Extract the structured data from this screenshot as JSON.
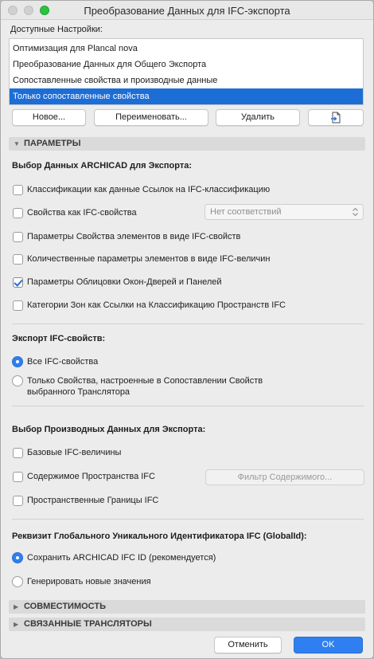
{
  "window": {
    "title": "Преобразование Данных для IFC-экспорта"
  },
  "presets": {
    "label": "Доступные Настройки:",
    "items": [
      "Оптимизация для Plancal nova",
      "Преобразование Данных для Общего Экспорта",
      "Сопоставленные свойства и производные данные",
      "Только сопоставленные свойства"
    ],
    "selected_index": 3
  },
  "preset_buttons": {
    "new": "Новое...",
    "rename": "Переименовать...",
    "delete": "Удалить",
    "import_icon": "import-icon"
  },
  "sections": {
    "params": "ПАРАМЕТРЫ",
    "compat": "СОВМЕСТИМОСТЬ",
    "linked": "СВЯЗАННЫЕ ТРАНСЛЯТОРЫ"
  },
  "export_data": {
    "heading": "Выбор Данных ARCHICAD для Экспорта:",
    "options": [
      {
        "label": "Классификации как данные Ссылок на IFC-классификацию",
        "checked": false
      },
      {
        "label": "Свойства как IFC-свойства",
        "checked": false
      },
      {
        "label": "Параметры Свойства элементов в виде IFC-свойств",
        "checked": false
      },
      {
        "label": "Количественные параметры элементов в виде IFC-величин",
        "checked": false
      },
      {
        "label": "Параметры Облицовки Окон-Дверей и Панелей",
        "checked": true
      },
      {
        "label": "Категории Зон как Ссылки на Классификацию Пространств IFC",
        "checked": false
      }
    ],
    "mapping_select": "Нет соответствий"
  },
  "ifc_props": {
    "heading": "Экспорт IFC-свойств:",
    "options": [
      {
        "label": "Все IFC-свойства",
        "selected": true
      },
      {
        "label_line1": "Только Свойства, настроенные в Сопоставлении Свойств",
        "label_line2": "выбранного Транслятора",
        "selected": false
      }
    ]
  },
  "derived": {
    "heading": "Выбор Производных Данных для Экспорта:",
    "options": [
      {
        "label": "Базовые IFC-величины",
        "checked": false
      },
      {
        "label": "Содержимое Пространства IFC",
        "checked": false
      },
      {
        "label": "Пространственные Границы IFC",
        "checked": false
      }
    ],
    "filter_button": "Фильтр Содержимого..."
  },
  "globalid": {
    "heading": "Реквизит Глобального Уникального Идентификатора IFC (GlobalId):",
    "options": [
      {
        "label": "Сохранить ARCHICAD IFC ID (рекомендуется)",
        "selected": true
      },
      {
        "label": "Генерировать новые значения",
        "selected": false
      }
    ]
  },
  "footer": {
    "cancel": "Отменить",
    "ok": "OK"
  },
  "colors": {
    "accent": "#2f7ff0",
    "selection": "#1d6dd6"
  }
}
